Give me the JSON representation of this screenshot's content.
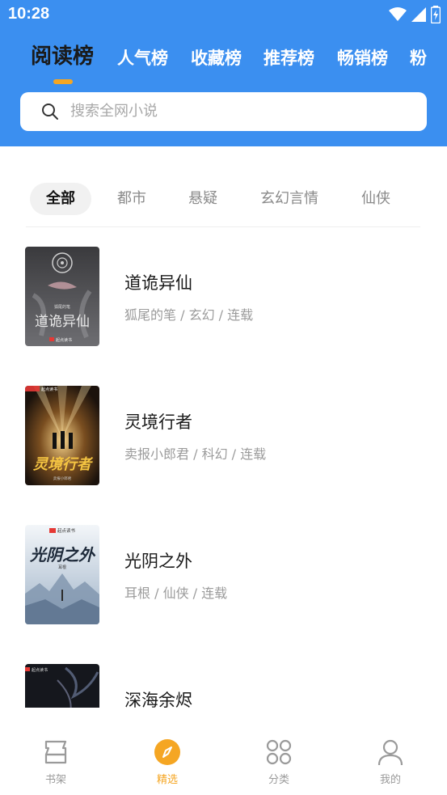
{
  "status_bar": {
    "time": "10:28"
  },
  "rank_tabs": [
    {
      "label": "阅读榜",
      "active": true
    },
    {
      "label": "人气榜",
      "active": false
    },
    {
      "label": "收藏榜",
      "active": false
    },
    {
      "label": "推荐榜",
      "active": false
    },
    {
      "label": "畅销榜",
      "active": false
    },
    {
      "label": "粉",
      "active": false
    }
  ],
  "search": {
    "placeholder": "搜索全网小说"
  },
  "category_tabs": [
    {
      "label": "全部",
      "active": true
    },
    {
      "label": "都市",
      "active": false
    },
    {
      "label": "悬疑",
      "active": false
    },
    {
      "label": "玄幻言情",
      "active": false
    },
    {
      "label": "仙侠",
      "active": false
    }
  ],
  "books": [
    {
      "title": "道诡异仙",
      "meta": "狐尾的笔 / 玄幻 / 连载",
      "cover_title": "道诡异仙",
      "cover_publisher": "起点读书",
      "cover_author": "狐尾的笔"
    },
    {
      "title": "灵境行者",
      "meta": "卖报小郎君 / 科幻 / 连载",
      "cover_title": "灵境行者",
      "cover_publisher": "起点读书",
      "cover_author": "卖报小郎君"
    },
    {
      "title": "光阴之外",
      "meta": "耳根 / 仙侠 / 连载",
      "cover_title": "光阴之外",
      "cover_publisher": "起点读书",
      "cover_author": "耳根"
    },
    {
      "title": "深海余烬",
      "meta": "",
      "cover_title": "",
      "cover_publisher": "起点读书",
      "cover_author": ""
    }
  ],
  "bottom_nav": [
    {
      "label": "书架",
      "icon": "bookshelf-icon",
      "active": false
    },
    {
      "label": "精选",
      "icon": "compass-icon",
      "active": true
    },
    {
      "label": "分类",
      "icon": "category-grid-icon",
      "active": false
    },
    {
      "label": "我的",
      "icon": "profile-icon",
      "active": false
    }
  ],
  "colors": {
    "header": "#3b8ff0",
    "accent": "#f5a623"
  }
}
